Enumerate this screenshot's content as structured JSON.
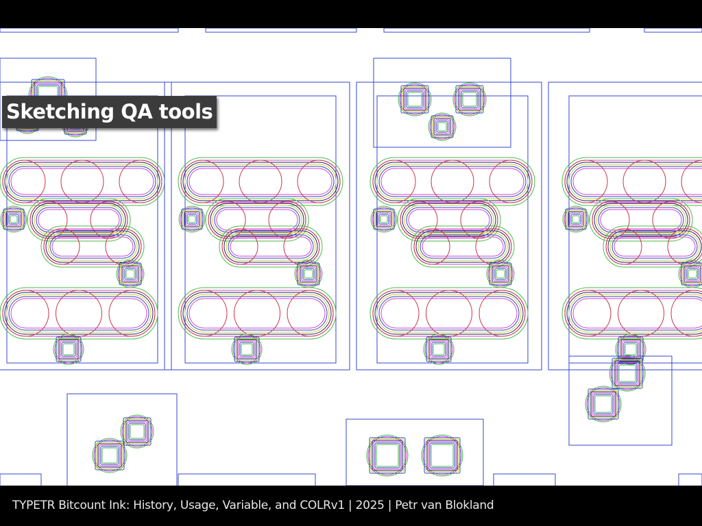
{
  "slide": {
    "title": "Sketching QA tools",
    "footer": "TYPETR Bitcount Ink: History, Usage, Variable, and COLRv1 | 2025 | Petr van Blokland"
  },
  "colors": {
    "background": "#ffffff",
    "frame_black": "#000000",
    "outline_blue": "#3344cc",
    "outline_green": "#44bb44",
    "outline_red": "#cc3344",
    "outline_magenta": "#cc44cc",
    "outline_yellow": "#cccc33",
    "outline_navy": "#222266",
    "title_box": "#3b3b3b"
  }
}
